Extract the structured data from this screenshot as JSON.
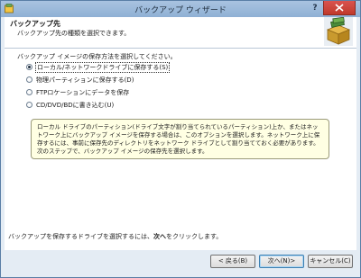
{
  "window": {
    "title": "バックアップ ウィザード",
    "help_label": "?"
  },
  "header": {
    "title": "バックアップ先",
    "subtitle": "バックアップ先の種類を選択できます。",
    "logo_icon": "backup-box-icon"
  },
  "content": {
    "prompt": "バックアップ イメージの保存方法を選択してください。",
    "options": [
      {
        "label": "ローカル/ネットワークドライブに保存する(S)",
        "checked": true
      },
      {
        "label": "物理パーティションに保存する(D)",
        "checked": false
      },
      {
        "label": "FTPロケーションにデータを保存",
        "checked": false
      },
      {
        "label": "CD/DVD/BDに書き込む(U)",
        "checked": false
      }
    ],
    "info_text": "ローカル ドライブのパーティション(ドライブ文字が割り当てられているパーティション)上か、またはネットワーク上にバックアップ イメージを保存する場合は、このオプションを選択します。ネットワーク上に保存するには、事前に保存先のディレクトリをネットワーク ドライブとして割り当てておく必要があります。次のステップで、バックアップ イメージの保存先を選択します。"
  },
  "status": {
    "text_before": "バックアップを保存するドライブを選択するには、",
    "text_bold": "次へ",
    "text_after": "をクリックします。"
  },
  "buttons": {
    "back": "< 戻る(B)",
    "next": "次へ(N)>",
    "cancel": "キャンセル(C)"
  },
  "colors": {
    "titlebar": "#9cb9da",
    "close": "#c9463b",
    "info_bg": "#ffffe3"
  }
}
